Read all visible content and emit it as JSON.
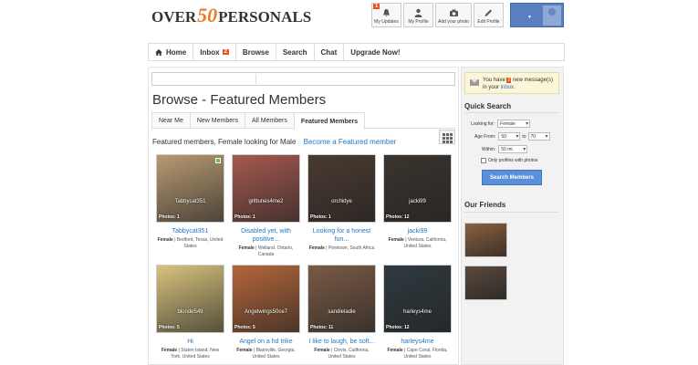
{
  "logo": {
    "part1": "OVER",
    "num": "50",
    "part2": "PERSONALS"
  },
  "top_icons": [
    {
      "label": "My Updates",
      "icon": "bell-icon",
      "badge": "1"
    },
    {
      "label": "My Profile",
      "icon": "user-icon"
    },
    {
      "label": "Add your photo",
      "icon": "camera-icon"
    },
    {
      "label": "Edit Profile",
      "icon": "pencil-icon"
    }
  ],
  "nav": {
    "home": "Home",
    "inbox": "Inbox",
    "inbox_badge": "2",
    "browse": "Browse",
    "search": "Search",
    "chat": "Chat",
    "upgrade": "Upgrade Now!"
  },
  "page_title": "Browse - Featured Members",
  "tabs": [
    "Near Me",
    "New Members",
    "All Members",
    "Featured Members"
  ],
  "subheading": "Featured members, Female looking for Male",
  "become_featured": "Become a Featured member",
  "members": [
    {
      "username": "Tabbycat351",
      "photos": "Photos: 1",
      "headline": "Tabbycat351",
      "gender": "Female",
      "location": "Bedford, Texas, United States",
      "online": true,
      "bg": "#b89a72"
    },
    {
      "username": "grittunes4me2",
      "photos": "Photos: 1",
      "headline": "Disabled yet, with positive...",
      "gender": "Female",
      "location": "Welland, Ontario, Canada",
      "online": false,
      "bg": "#a4594f"
    },
    {
      "username": "orchidye",
      "photos": "Photos: 1",
      "headline": "Looking for a honest fun...",
      "gender": "Female",
      "location": "Pinetown, South Africa",
      "online": false,
      "bg": "#4a3a30"
    },
    {
      "username": "jacki99",
      "photos": "Photos: 12",
      "headline": "jacki99",
      "gender": "Female",
      "location": "Ventura, California, United States",
      "online": false,
      "bg": "#3b342e"
    },
    {
      "username": "blonde549",
      "photos": "Photos: 5",
      "headline": "Hi",
      "gender": "Female",
      "location": "Staten Island, New York, United States",
      "online": false,
      "bg": "#d8c27c"
    },
    {
      "username": "Angelwings50ce7",
      "photos": "Photos: 5",
      "headline": "Angel on a hd trike",
      "gender": "Female",
      "location": "Blairsville, Georgia, United States",
      "online": false,
      "bg": "#b4663a"
    },
    {
      "username": "sandieladie",
      "photos": "Photos: 11",
      "headline": "I like to laugh, be soft...",
      "gender": "Female",
      "location": "Clovis, California, United States",
      "online": false,
      "bg": "#7a5a45"
    },
    {
      "username": "harleys4me",
      "photos": "Photos: 12",
      "headline": "harleys4me",
      "gender": "Female",
      "location": "Cape Coral, Florida, United States",
      "online": false,
      "bg": "#2f3a40"
    }
  ],
  "messages": {
    "prefix": "You have",
    "count": "2",
    "suffix": "new message(s) in your",
    "link": "inbox."
  },
  "quick_search": {
    "title": "Quick Search",
    "looking_for_label": "Looking for:",
    "looking_for_value": "Female",
    "age_from_label": "Age From:",
    "age_from_value": "50",
    "to_label": "to",
    "age_to_value": "70",
    "within_label": "Within:",
    "within_value": "50 mi.",
    "photos_only_label": "Only profiles with photos",
    "search_button": "Search Members"
  },
  "our_friends": {
    "title": "Our Friends",
    "photos": [
      "#8a6040",
      "#5a4a3e"
    ]
  },
  "colors": {
    "accent": "#f07a22",
    "link": "#2277c4",
    "badge": "#e8521b",
    "button": "#5a8fd9"
  }
}
